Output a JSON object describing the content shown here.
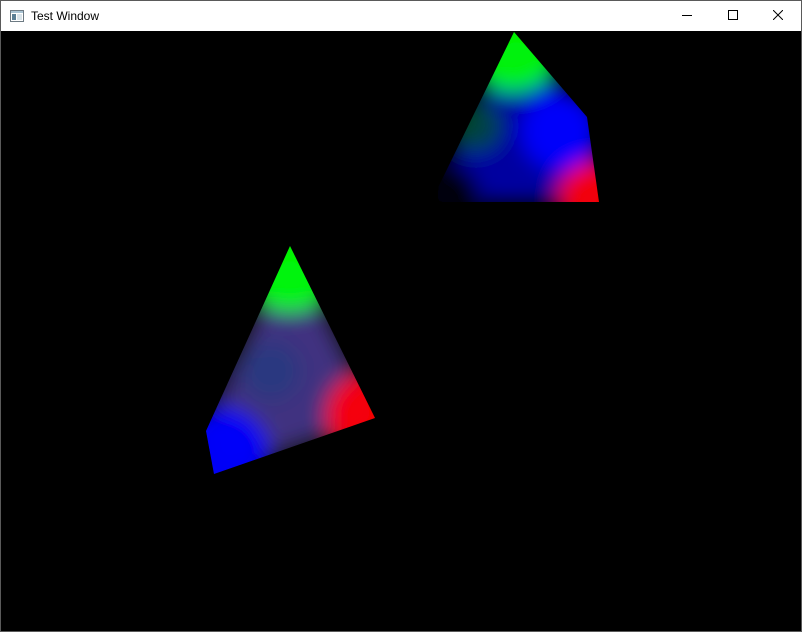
{
  "window": {
    "title": "Test Window",
    "app_icon": "window-app-icon",
    "controls": {
      "minimize_icon": "minimize-icon",
      "maximize_icon": "maximize-icon",
      "close_icon": "close-icon"
    }
  },
  "scene": {
    "background": "#000000",
    "vertex_colors": {
      "red": "#ff0000",
      "green": "#00ff00",
      "blue": "#0000ff"
    }
  }
}
